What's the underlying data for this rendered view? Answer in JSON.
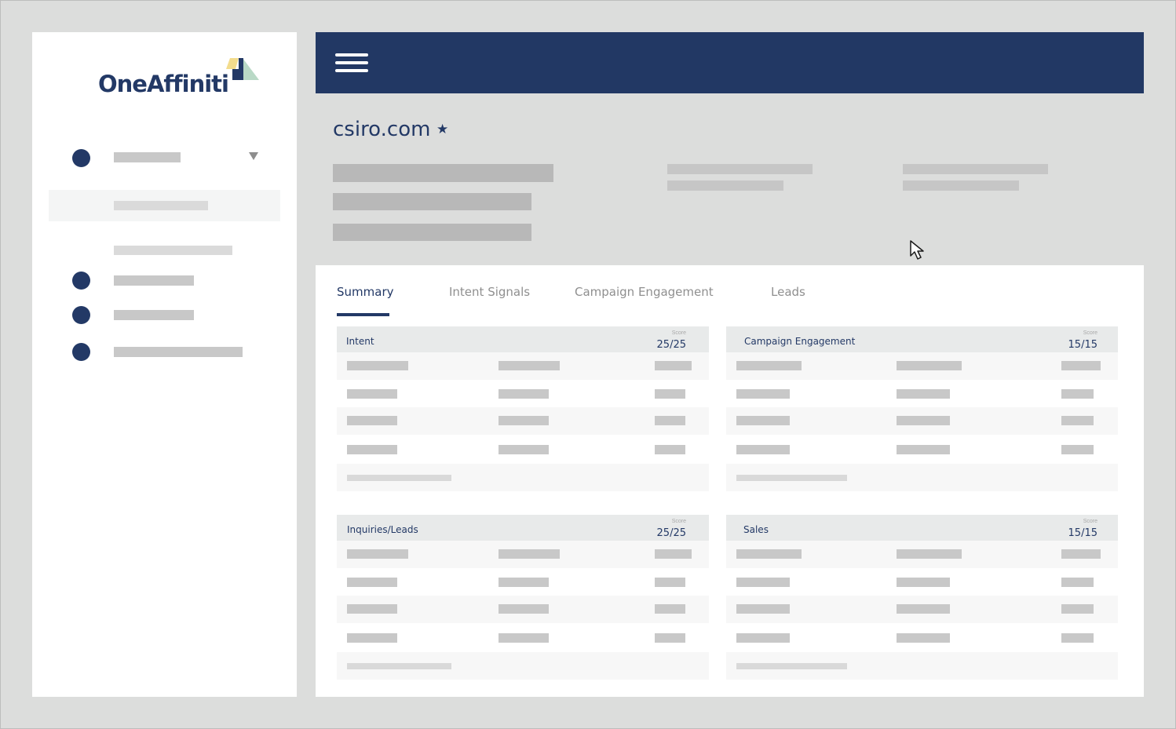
{
  "app": {
    "logo_text": "OneAffiniti"
  },
  "account": {
    "domain": "csiro.com",
    "favorite_icon": "star-icon"
  },
  "tabs": [
    {
      "label": "Summary",
      "active": true
    },
    {
      "label": "Intent Signals",
      "active": false
    },
    {
      "label": "Campaign Engagement",
      "active": false
    },
    {
      "label": "Leads",
      "active": false
    }
  ],
  "cards": [
    {
      "title": "Intent",
      "score_label": "Score",
      "score": "25/25"
    },
    {
      "title": "Campaign Engagement",
      "score_label": "Score",
      "score": "15/15"
    },
    {
      "title": "Inquiries/Leads",
      "score_label": "Score",
      "score": "25/25"
    },
    {
      "title": "Sales",
      "score_label": "Score",
      "score": "15/15"
    }
  ],
  "colors": {
    "brand_navy": "#223864",
    "logo_yellow": "#f3dc8d",
    "logo_green": "#b9d9c6"
  }
}
